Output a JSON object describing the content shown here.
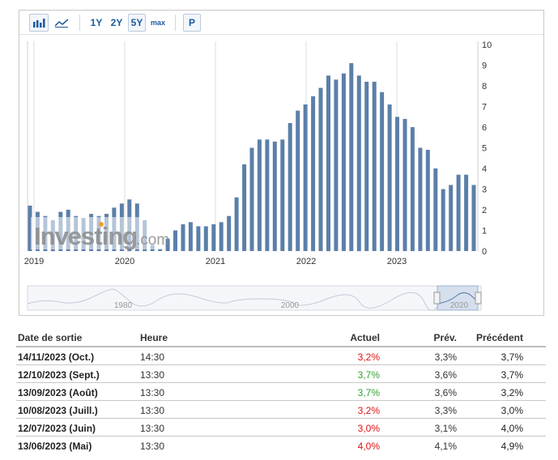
{
  "toolbar": {
    "chart_types": [
      {
        "icon": "bar-chart-icon"
      },
      {
        "icon": "area-chart-icon"
      }
    ],
    "ranges": [
      "1Y",
      "2Y",
      "5Y",
      "max"
    ],
    "active_range": "5Y",
    "extra": "P"
  },
  "watermark": {
    "brand": "Investing",
    "suffix": ".com"
  },
  "navigator": {
    "labels": [
      "1980",
      "2000",
      "2020"
    ]
  },
  "colors": {
    "bar": "#5b7fa9",
    "bar_light": "#a9b8cc",
    "axis": "#333333",
    "grid": "#dcdcdc",
    "negative": "#dd1111",
    "positive": "#2fa22f"
  },
  "chart_data": {
    "type": "bar",
    "y_axis_side": "right",
    "ylim": [
      0,
      10
    ],
    "y_ticks": [
      "0",
      "1",
      "2",
      "3",
      "4",
      "5",
      "6",
      "7",
      "8",
      "9",
      "10"
    ],
    "x_tick_labels": [
      "2019",
      "2020",
      "2021",
      "2022",
      "2023"
    ],
    "grid": "vertical at year marks",
    "values": [
      2.2,
      1.9,
      1.7,
      1.5,
      1.9,
      2.0,
      1.7,
      1.6,
      1.8,
      1.7,
      1.8,
      2.1,
      2.3,
      2.5,
      2.3,
      1.5,
      0.3,
      0.1,
      0.6,
      1.0,
      1.3,
      1.4,
      1.2,
      1.2,
      1.3,
      1.4,
      1.7,
      2.6,
      4.2,
      5.0,
      5.4,
      5.4,
      5.3,
      5.4,
      6.2,
      6.8,
      7.1,
      7.5,
      7.9,
      8.5,
      8.3,
      8.6,
      9.1,
      8.5,
      8.2,
      8.2,
      7.7,
      7.1,
      6.5,
      6.4,
      6.0,
      5.0,
      4.9,
      4.0,
      3.0,
      3.2,
      3.7,
      3.7,
      3.2
    ]
  },
  "table": {
    "headers": {
      "date": "Date de sortie",
      "time": "Heure",
      "actual": "Actuel",
      "prev": "Prév.",
      "preced": "Précédent"
    },
    "rows": [
      {
        "date": "14/11/2023 (Oct.)",
        "time": "14:30",
        "actual": "3,2%",
        "actual_dir": "neg",
        "prev": "3,3%",
        "preced": "3,7%"
      },
      {
        "date": "12/10/2023 (Sept.)",
        "time": "13:30",
        "actual": "3,7%",
        "actual_dir": "pos",
        "prev": "3,6%",
        "preced": "3,7%"
      },
      {
        "date": "13/09/2023 (Août)",
        "time": "13:30",
        "actual": "3,7%",
        "actual_dir": "pos",
        "prev": "3,6%",
        "preced": "3,2%"
      },
      {
        "date": "10/08/2023 (Juill.)",
        "time": "13:30",
        "actual": "3,2%",
        "actual_dir": "neg",
        "prev": "3,3%",
        "preced": "3,0%"
      },
      {
        "date": "12/07/2023 (Juin)",
        "time": "13:30",
        "actual": "3,0%",
        "actual_dir": "neg",
        "prev": "3,1%",
        "preced": "4,0%"
      },
      {
        "date": "13/06/2023 (Mai)",
        "time": "13:30",
        "actual": "4,0%",
        "actual_dir": "neg",
        "prev": "4,1%",
        "preced": "4,9%"
      }
    ]
  }
}
